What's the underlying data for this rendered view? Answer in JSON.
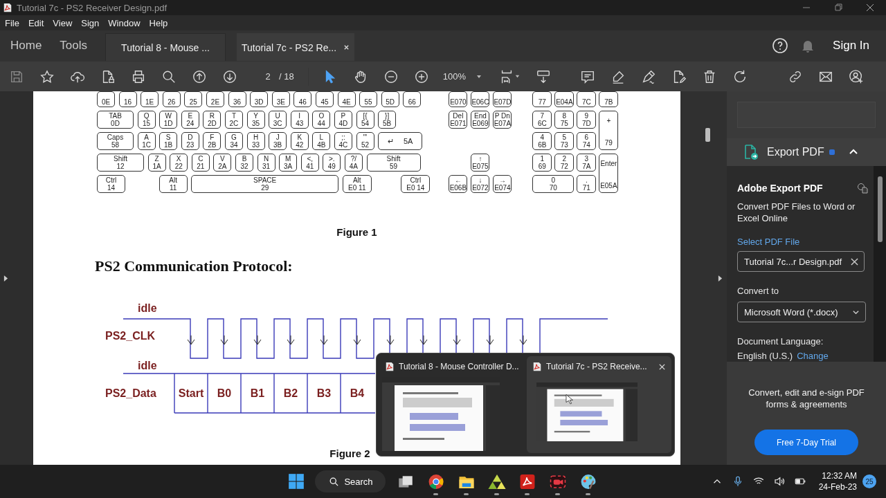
{
  "window": {
    "title": "Tutorial 7c - PS2 Receiver Design.pdf"
  },
  "menu": [
    "File",
    "Edit",
    "View",
    "Sign",
    "Window",
    "Help"
  ],
  "nav_tabs": [
    "Home",
    "Tools"
  ],
  "doc_tabs": [
    {
      "label": "Tutorial 8 - Mouse ...",
      "selected": false
    },
    {
      "label": "Tutorial 7c - PS2 Re...",
      "selected": true
    }
  ],
  "sign_in": "Sign In",
  "toolbar": {
    "left_tools": [
      {
        "kind": "save"
      },
      {
        "kind": "star"
      },
      {
        "kind": "upload"
      },
      {
        "kind": "file-lock"
      },
      {
        "kind": "print"
      },
      {
        "kind": "zoom-search"
      },
      {
        "kind": "page-up"
      },
      {
        "kind": "page-down"
      }
    ],
    "page": "2",
    "page_total": "/ 18",
    "modes": [
      {
        "kind": "select",
        "selected": true
      },
      {
        "kind": "hand",
        "selected": false
      }
    ],
    "zoom_tools": [
      {
        "kind": "zoom-out"
      },
      {
        "kind": "zoom-in"
      }
    ],
    "zoom": "100%",
    "right_tools": [
      {
        "kind": "fit-page"
      },
      {
        "kind": "keyboard-download"
      },
      {
        "kind": "comment"
      },
      {
        "kind": "highlight"
      },
      {
        "kind": "sign"
      },
      {
        "kind": "edit"
      },
      {
        "kind": "delete"
      },
      {
        "kind": "rotate"
      },
      {
        "kind": "share-link"
      },
      {
        "kind": "mail"
      },
      {
        "kind": "add-user"
      }
    ]
  },
  "document": {
    "keyboard": {
      "main": [
        [
          {
            "b": "0E",
            "kind": "key"
          },
          {
            "b": "16",
            "kind": "key"
          },
          {
            "b": "1E",
            "kind": "key"
          },
          {
            "b": "26",
            "kind": "key"
          },
          {
            "b": "25",
            "kind": "key"
          },
          {
            "b": "2E",
            "kind": "key"
          },
          {
            "b": "36",
            "kind": "key"
          },
          {
            "b": "3D",
            "kind": "key"
          },
          {
            "b": "3E",
            "kind": "key"
          },
          {
            "b": "46",
            "kind": "key"
          },
          {
            "b": "45",
            "kind": "key"
          },
          {
            "b": "4E",
            "kind": "key"
          },
          {
            "b": "55",
            "kind": "key"
          },
          {
            "b": "5D",
            "kind": "key"
          },
          {
            "b": "66",
            "kind": "key"
          }
        ],
        [
          {
            "t": "TAB",
            "b": "0D",
            "kind": "tab"
          },
          {
            "t": "Q",
            "b": "15",
            "kind": "key"
          },
          {
            "t": "W",
            "b": "1D",
            "kind": "key"
          },
          {
            "t": "E",
            "b": "24",
            "kind": "key"
          },
          {
            "t": "R",
            "b": "2D",
            "kind": "key"
          },
          {
            "t": "T",
            "b": "2C",
            "kind": "key"
          },
          {
            "t": "Y",
            "b": "35",
            "kind": "key"
          },
          {
            "t": "U",
            "b": "3C",
            "kind": "key"
          },
          {
            "t": "I",
            "b": "43",
            "kind": "key"
          },
          {
            "t": "O",
            "b": "44",
            "kind": "key"
          },
          {
            "t": "P",
            "b": "4D",
            "kind": "key"
          },
          {
            "t": "[{",
            "b": "54",
            "kind": "key"
          },
          {
            "t": "}]",
            "b": "5B",
            "kind": "key"
          }
        ],
        [
          {
            "t": "Caps",
            "b": "58",
            "kind": "caps"
          },
          {
            "t": "A",
            "b": "1C",
            "kind": "key"
          },
          {
            "t": "S",
            "b": "1B",
            "kind": "key"
          },
          {
            "t": "D",
            "b": "23",
            "kind": "key"
          },
          {
            "t": "F",
            "b": "2B",
            "kind": "key"
          },
          {
            "t": "G",
            "b": "34",
            "kind": "key"
          },
          {
            "t": "H",
            "b": "33",
            "kind": "key"
          },
          {
            "t": "J",
            "b": "3B",
            "kind": "key"
          },
          {
            "t": "K",
            "b": "42",
            "kind": "key"
          },
          {
            "t": "L",
            "b": "4B",
            "kind": "key"
          },
          {
            "t": ";:",
            "b": "4C",
            "kind": "key"
          },
          {
            "t": "\"'",
            "b": "52",
            "kind": "key"
          },
          {
            "t": "↵",
            "b": "5A",
            "kind": "enter"
          }
        ],
        [
          {
            "t": "Shift",
            "b": "12",
            "kind": "shift"
          },
          {
            "t": "Z",
            "b": "1A",
            "kind": "key"
          },
          {
            "t": "X",
            "b": "22",
            "kind": "key"
          },
          {
            "t": "C",
            "b": "21",
            "kind": "key"
          },
          {
            "t": "V",
            "b": "2A",
            "kind": "key"
          },
          {
            "t": "B",
            "b": "32",
            "kind": "key"
          },
          {
            "t": "N",
            "b": "31",
            "kind": "key"
          },
          {
            "t": "M",
            "b": "3A",
            "kind": "key"
          },
          {
            "t": "<,",
            "b": "41",
            "kind": "key"
          },
          {
            "t": ">.",
            "b": "49",
            "kind": "key"
          },
          {
            "t": "?/",
            "b": "4A",
            "kind": "key"
          },
          {
            "t": "Shift",
            "b": "59",
            "kind": "shift-right"
          }
        ],
        [
          {
            "t": "Ctrl",
            "b": "14",
            "kind": "ctrl"
          },
          {
            "t": "Alt",
            "b": "11",
            "kind": "alt"
          },
          {
            "t": "SPACE",
            "b": "29",
            "kind": "space"
          },
          {
            "t": "Alt",
            "b": "E0 11",
            "kind": "alt-right"
          },
          {
            "t": "Ctrl",
            "b": "E0 14",
            "kind": "ctrl-right"
          }
        ]
      ],
      "nav": [
        {
          "b": "E070",
          "kind": "key"
        },
        {
          "b": "E06C",
          "kind": "key"
        },
        {
          "b": "E07D",
          "kind": "key"
        },
        {
          "t": "Del",
          "b": "E071",
          "kind": "key"
        },
        {
          "t": "End",
          "b": "E069",
          "kind": "key"
        },
        {
          "t": "P Dn",
          "b": "E07A",
          "kind": "key"
        },
        {
          "t": "↑",
          "b": "E075",
          "kind": "up"
        },
        {
          "t": "←",
          "b": "E06B",
          "kind": "left"
        },
        {
          "t": "↓",
          "b": "E072",
          "kind": "down"
        },
        {
          "t": "→",
          "b": "E074",
          "kind": "right"
        }
      ],
      "numpad": [
        {
          "b": "77",
          "kind": "key"
        },
        {
          "b": "E04A",
          "kind": "key"
        },
        {
          "b": "7C",
          "kind": "key"
        },
        {
          "b": "7B",
          "kind": "key"
        },
        {
          "t": "7",
          "b": "6C",
          "kind": "key"
        },
        {
          "t": "8",
          "b": "75",
          "kind": "key"
        },
        {
          "t": "9",
          "b": "7D",
          "kind": "key"
        },
        {
          "t": "4",
          "b": "6B",
          "kind": "key"
        },
        {
          "t": "5",
          "b": "73",
          "kind": "key"
        },
        {
          "t": "6",
          "b": "74",
          "kind": "key"
        },
        {
          "t": "+",
          "b": "79",
          "kind": "tall"
        },
        {
          "t": "1",
          "b": "69",
          "kind": "key"
        },
        {
          "t": "2",
          "b": "72",
          "kind": "key"
        },
        {
          "t": "3",
          "b": "7A",
          "kind": "key"
        },
        {
          "t": "0",
          "b": "70",
          "kind": "wide"
        },
        {
          "t": ".",
          "b": "71",
          "kind": "key"
        },
        {
          "t": "Enter",
          "b": "E05A",
          "kind": "tall"
        }
      ]
    },
    "figure_1": "Figure 1",
    "heading": "PS2 Communication Protocol:",
    "diagram": {
      "idle_labels": [
        "idle",
        "idle"
      ],
      "signals": [
        "PS2_CLK",
        "PS2_Data"
      ],
      "bits": [
        "Start",
        "B0",
        "B1",
        "B2",
        "B3",
        "B4"
      ]
    },
    "figure_2": "Figure 2"
  },
  "panel": {
    "export_title": "Export PDF",
    "expanded": true,
    "heading": "Adobe Export PDF",
    "description": "Convert PDF Files to Word or Excel Online",
    "select_label": "Select PDF File",
    "file": "Tutorial 7c...r Design.pdf",
    "convert_label": "Convert to",
    "format": "Microsoft Word (*.docx)",
    "language_label": "Document Language:",
    "language": "English (U.S.)",
    "change": "Change",
    "promo": "Convert, edit and e-sign PDF forms & agreements",
    "trial": "Free 7-Day Trial"
  },
  "preview": [
    {
      "title": "Tutorial 8 - Mouse Controller D...",
      "selected": false
    },
    {
      "title": "Tutorial 7c - PS2 Receive...",
      "selected": true
    }
  ],
  "taskbar": {
    "search": "Search",
    "apps": [
      {
        "kind": "task-view",
        "running": false
      },
      {
        "kind": "browser",
        "running": true
      },
      {
        "kind": "folder",
        "running": true
      },
      {
        "kind": "triangle",
        "running": true
      },
      {
        "kind": "pdf",
        "running": true
      },
      {
        "kind": "recorder",
        "running": true
      },
      {
        "kind": "paint",
        "running": true
      }
    ],
    "tray": [
      {
        "kind": "chevron"
      },
      {
        "kind": "mic"
      },
      {
        "kind": "wifi"
      },
      {
        "kind": "volume"
      },
      {
        "kind": "battery"
      }
    ],
    "time": "12:32 AM",
    "date": "24-Feb-23",
    "notifications": "25"
  }
}
